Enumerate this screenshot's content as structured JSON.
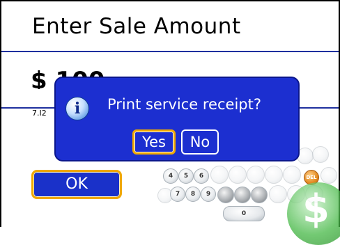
{
  "header": {
    "title": "Enter Sale Amount"
  },
  "form": {
    "amount": "$ 100",
    "note": "7.I2"
  },
  "buttons": {
    "ok_label": "OK"
  },
  "dialog": {
    "message": "Print service receipt?",
    "icon": "info-icon",
    "yes_label": "Yes",
    "no_label": "No"
  },
  "keypad": {
    "row1": [
      "4",
      "5",
      "6"
    ],
    "row2": [
      "7",
      "8",
      "9"
    ],
    "zero": "0",
    "orange_key": "DEL"
  },
  "watermark": {
    "symbol": "$"
  },
  "colors": {
    "dialog_bg": "#1c2fd0",
    "focus_border": "#f0a800",
    "rule": "#1e2f9e"
  }
}
